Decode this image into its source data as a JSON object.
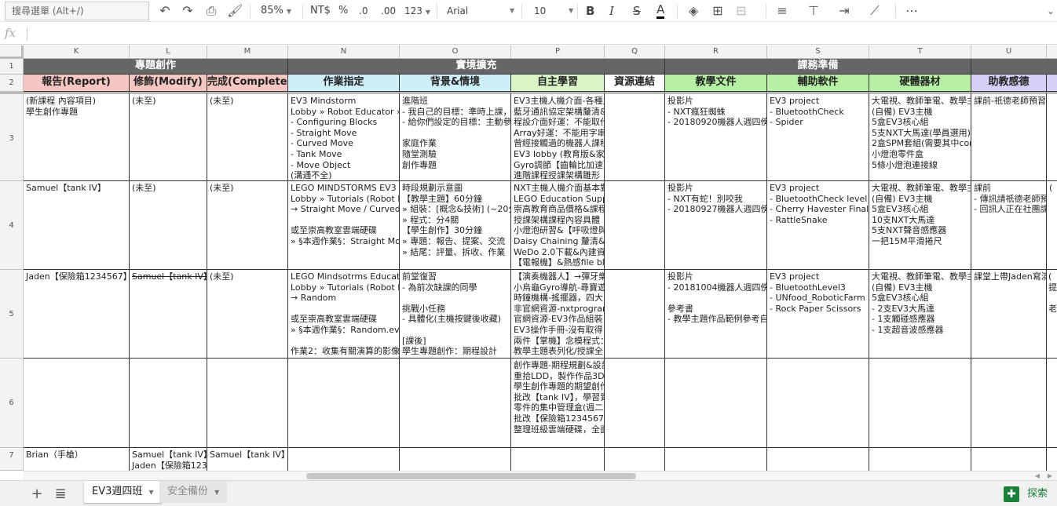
{
  "toolbar": {
    "menu_search": "搜尋選單 (Alt+/)",
    "zoom": "85%",
    "currency": "NT$",
    "percent": "%",
    "decimal_decrease": ".0",
    "decimal_increase": ".00",
    "number_format": "123",
    "font": "Arial",
    "font_size": "10",
    "bold": "B",
    "italic": "I",
    "strike": "S",
    "text_color": "A",
    "more": "⋯"
  },
  "formula_bar": {
    "fx": "fx",
    "value": ""
  },
  "columns": [
    "K",
    "L",
    "M",
    "N",
    "O",
    "P",
    "Q",
    "R",
    "S",
    "T",
    "U"
  ],
  "rows": [
    "1",
    "2",
    "3",
    "4",
    "5",
    "6",
    "7"
  ],
  "groups": {
    "project": "專題創作",
    "context": "實境擴充",
    "prep": "課務準備"
  },
  "headers": {
    "report": "報告(Report)",
    "modify": "修飾(Modify)",
    "complete": "完成(Complete)",
    "assignment": "作業指定",
    "background": "背景&情境",
    "self_study": "自主學習",
    "resources": "資源連結",
    "teaching_docs": "教學文件",
    "software": "輔助軟件",
    "hardware": "硬體器材",
    "ta_notes": "助教感德"
  },
  "cells": {
    "r3": {
      "K": "(新課程 內容項目)\n學生創作專題",
      "L": "(未至)",
      "M": "(未至)",
      "N": "EV3 Mindstorm\nLobby » Robot Educator » »\n- Configuring Blocks\n- Straight Move\n- Curved Move\n- Tank Move\n- Move Object\n(溝通不全)",
      "O": "進階班\n- 我自己的目標：準時上課，\n- 給你們設定的目標：主動參\n\n家庭作業\n隨堂測驗\n創作專題",
      "P": "EV3主機人機介面-各種主\n藍牙通訊協定架構釐清&\n程設介面好運：不能取代\nArray好運：不能用字串\n曾經接觸過的機器人課程\nEV3 lobby (教育版&家用\nGyro調節【齒輪比加速】\n進階課程授課架構雛形",
      "Q": "",
      "R": "投影片\n- NXT瘋狂蜘蛛\n- 20180920機器人週四傍晚",
      "S": "EV3 project\n- BluetoothCheck\n- Spider",
      "T": "大電視、教師筆電、教學主\n(自備) EV3主機\n5盒EV3核心組\n5支NXT大馬達(學員選用)\n2盒SPM套組(需要其中cor\n小燈泡零件盒\n5條小燈泡連接線",
      "U": "課前-祇德老師預習"
    },
    "r4": {
      "K": "Samuel【tank IV】",
      "L": "(未至)",
      "M": "(未至)",
      "N": "LEGO MINDSTORMS EV3\nLobby » Tutorials (Robot Ed\n→ Straight Move / Curved M\n\n或至崇高教室雲端硬碟\n» §本週作業§：Straight Mov",
      "O": "時段規劃示意圖\n【教學主題】60分鐘\n» 組裝：[概念&技術] (~20分\n» 程式：分4關\n【學生創作】30分鐘\n» 專題：報告、提案、交流\n» 結尾：評量、拆收、作業",
      "P": "NXT主機人機介面基本對\nLEGO Education Suppo\n崇高教育商品價格&課程\n授課架構課程內容具體\n小燈泡研習&【呼吸燈與\nDaisy Chaining 釐清&實\nWeDo 2.0下載&內建資源\n【電報機】&熱感file blo",
      "Q": "",
      "R": "投影片\n- NXT有蛇！別咬我\n- 20180927機器人週四傍晚",
      "S": "EV3 project\n- BluetoothCheck level 2\n- Cherry Havester Final\n- RattleSnake",
      "T": "大電視、教師筆電、教學主\n(自備) EV3主機\n5盒EV3核心組\n10支NXT大馬達\n5支NXT聲音感應器\n一把15M平滑捲尺",
      "U": "課前\n- 傳訊請祇德老師預\n- 回訊人正在社團課"
    },
    "r5": {
      "K": "Jaden【保險箱1234567】",
      "L": "Samuel【tank IV】",
      "M": "(未至)",
      "N": "LEGO Mindsotrms Educatio\nLobby » Tutorials (Robot Ed\n→ Random\n\n或至崇高教室雲端硬碟\n» §本週作業§：Random.ev3\n\n作業2：收集有關演算的影像",
      "O": "前堂復習\n- 為前次缺課的同學\n\n挑戰小任務\n- 具體化(主機按鍵後收藏)\n\n[課後]\n學生專題創作：期程設計",
      "P": "【演奏機器人】→彈牙樂\n小烏龜Gyro導航-尋寶遊\n時鐘機構-搖擺器，四大\n非官網資源-nxtprogram\n官網資源-EV3作品組裝\nEV3操作手冊-沒有取得\n兩件【掌機】念模程式：\n教學主題表列化/授課全",
      "Q": "",
      "R": "投影片\n- 20181004機器人週四傍晚\n\n參考書\n- 教學主題作品範例參考自",
      "S": "EV3 project\n- BluetoothLevel3\n- UNfood_RoboticFarm (u\n- Rock Paper Scissors",
      "T": "大電視、教師筆電、教學主\n(自備) EV3主機\n5盒EV3核心組\n- 2支EV3大馬達\n- 1支觸碰感應器\n- 1支超音波感應器",
      "U": "課堂上帶Jaden寫演"
    },
    "r6": {
      "P": "創作專題-期程規劃&設計\n重拾LDD，製作作品3D\n學生創作專題的期望創作\n批改【tank IV】，學習到\n零件的集中管理盒(週二上\n批改【保險箱1234567】\n整理班級雲端硬碟，全面"
    },
    "r7": {
      "K": "Brian（手槍）",
      "L": "Samuel【tank IV】\nJaden【保險箱1234",
      "M": "Samuel【tank IV】"
    }
  },
  "peek": {
    "r4": "(",
    "r5a": "(",
    "r5b": "提",
    "r5c": "老"
  },
  "sheets": {
    "active": "EV3週四班",
    "inactive": "安全備份",
    "explore": "探索"
  },
  "colors": {
    "report_bg": "#f4c7c3",
    "assignment_bg": "#cfeff8",
    "background_bg": "#cfeff8",
    "self_study_bg": "#d9f5c7",
    "resources_bg": "#ffffff",
    "prep_green": "#b7f0a5",
    "ta_bg": "#d6d0f7",
    "group_bg": "#666666"
  }
}
